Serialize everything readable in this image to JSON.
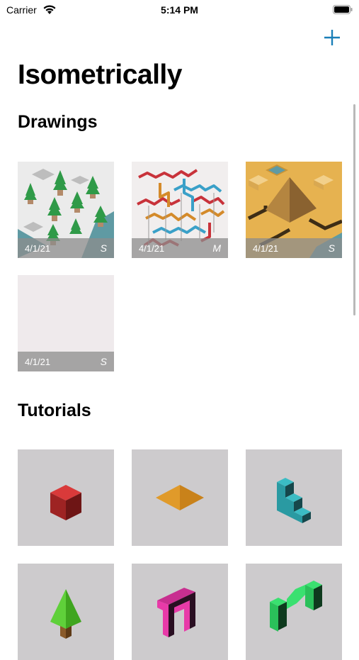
{
  "status_bar": {
    "carrier": "Carrier",
    "time": "5:14 PM"
  },
  "header": {
    "title": "Isometrically",
    "add_icon": "plus-icon",
    "accent_color": "#1a7fb8"
  },
  "drawings": {
    "heading": "Drawings",
    "items": [
      {
        "date": "4/1/21",
        "size": "S",
        "thumb": "forest"
      },
      {
        "date": "4/1/21",
        "size": "M",
        "thumb": "maze"
      },
      {
        "date": "4/1/21",
        "size": "S",
        "thumb": "pyramid"
      },
      {
        "date": "4/1/21",
        "size": "S",
        "thumb": "blank"
      }
    ]
  },
  "tutorials": {
    "heading": "Tutorials",
    "items": [
      {
        "thumb": "red-cube"
      },
      {
        "thumb": "orange-rhombus"
      },
      {
        "thumb": "teal-stairs"
      },
      {
        "thumb": "green-tree"
      },
      {
        "thumb": "magenta-arch"
      },
      {
        "thumb": "green-arch"
      }
    ]
  }
}
